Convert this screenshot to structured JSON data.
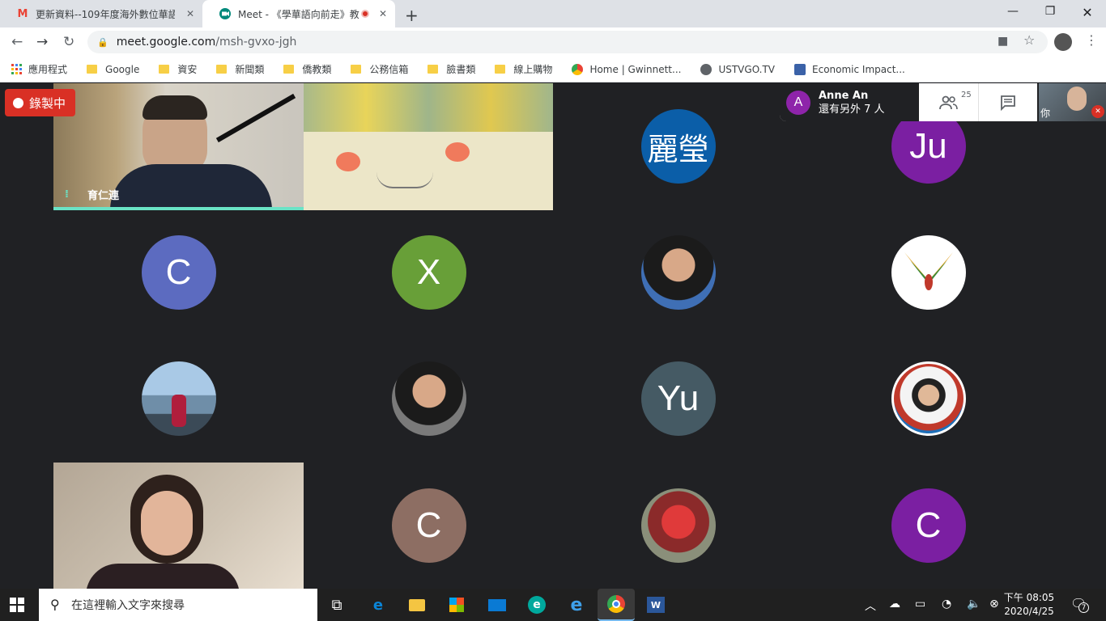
{
  "browser": {
    "tabs": [
      {
        "title": "更新資料--109年度海外數位華語",
        "favicon": "gmail-icon",
        "active": false
      },
      {
        "title": "Meet - 《學華語向前走》教",
        "favicon": "meet-icon",
        "active": true,
        "recording": true
      }
    ],
    "url_host": "meet.google.com",
    "url_path": "/msh-gvxo-jgh",
    "bookmarks": [
      {
        "label": "應用程式",
        "icon": "apps-icon"
      },
      {
        "label": "Google",
        "icon": "folder-icon"
      },
      {
        "label": "資安",
        "icon": "folder-icon"
      },
      {
        "label": "新聞類",
        "icon": "folder-icon"
      },
      {
        "label": "僑教類",
        "icon": "folder-icon"
      },
      {
        "label": "公務信箱",
        "icon": "folder-icon"
      },
      {
        "label": "臉書類",
        "icon": "folder-icon"
      },
      {
        "label": "線上購物",
        "icon": "folder-icon"
      },
      {
        "label": "Home | Gwinnett...",
        "icon": "site-icon"
      },
      {
        "label": "USTVGO.TV",
        "icon": "globe-icon"
      },
      {
        "label": "Economic Impact...",
        "icon": "site-icon"
      }
    ]
  },
  "meet": {
    "recording_label": "錄製中",
    "presenter_label": "育仁連",
    "top_user_initial": "A",
    "top_user_name": "Anne An",
    "top_user_others": "還有另外 7 人",
    "participant_count": "25",
    "self_label": "你",
    "avatars": [
      {
        "text": "麗瑩",
        "color": "#0b5ea8"
      },
      {
        "text": "Ju",
        "color": "#7b1fa2"
      },
      {
        "text": "C",
        "color": "#5c6bc0"
      },
      {
        "text": "X",
        "color": "#689f38"
      },
      {
        "text": "",
        "color": "#8a8f96"
      },
      {
        "text": "",
        "color": "#ffffff"
      },
      {
        "text": "",
        "color": "#8fb3cf"
      },
      {
        "text": "",
        "color": "#7a7a7a"
      },
      {
        "text": "Yu",
        "color": "#455a64"
      },
      {
        "text": "",
        "color": "#1e6fb8"
      },
      {
        "text": "C",
        "color": "#8d6e63"
      },
      {
        "text": "",
        "color": "#8b2a2a"
      },
      {
        "text": "C",
        "color": "#7b1fa2"
      }
    ]
  },
  "taskbar": {
    "search_placeholder": "在這裡輸入文字來搜尋",
    "time": "下午 08:05",
    "date": "2020/4/25",
    "notifications": "7"
  }
}
